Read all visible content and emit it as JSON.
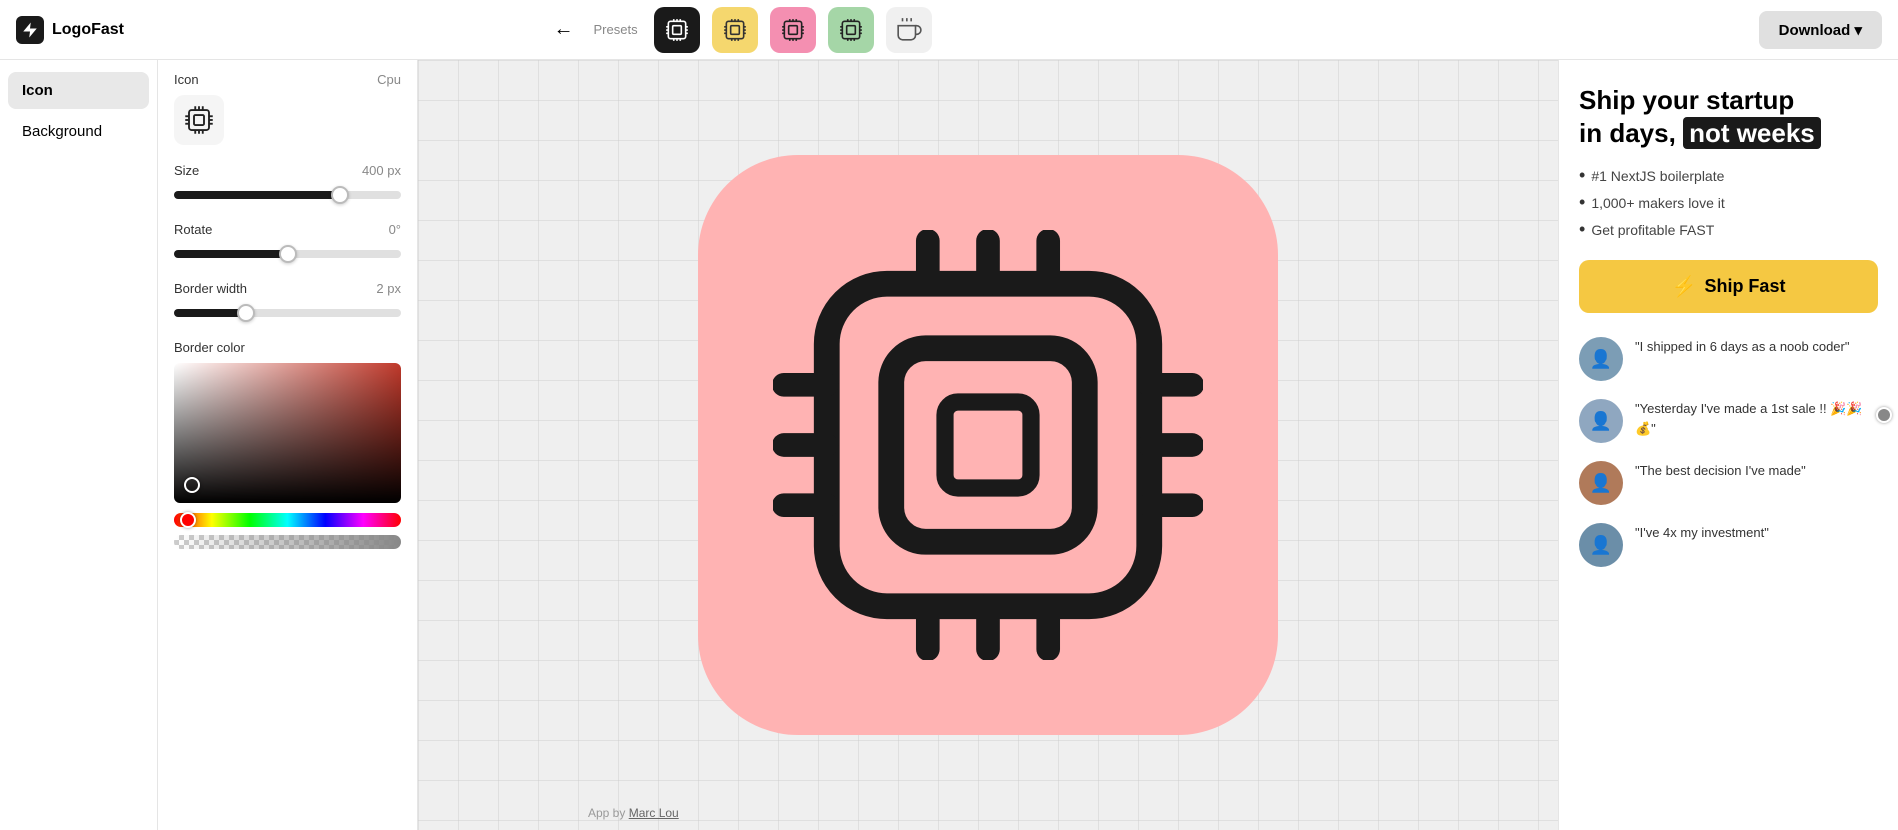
{
  "app": {
    "name": "LogoFast",
    "logo_symbol": "⚡"
  },
  "topbar": {
    "presets_label": "Presets",
    "download_label": "Download ▾"
  },
  "sidebar": {
    "tabs": [
      {
        "id": "icon",
        "label": "Icon",
        "active": true
      },
      {
        "id": "background",
        "label": "Background",
        "active": false
      }
    ]
  },
  "controls": {
    "icon_label": "Icon",
    "icon_value": "Cpu",
    "size_label": "Size",
    "size_value": "400 px",
    "size_pct": 75,
    "rotate_label": "Rotate",
    "rotate_value": "0°",
    "rotate_pct": 50,
    "border_width_label": "Border width",
    "border_width_value": "2 px",
    "border_width_pct": 30,
    "border_color_label": "Border color"
  },
  "right_panel": {
    "headline_1": "Ship your startup",
    "headline_2": "in days,",
    "headline_highlight": "not weeks",
    "bullets": [
      "#1 NextJS boilerplate",
      "1,000+ makers love it",
      "Get profitable FAST"
    ],
    "cta_label": "Ship Fast",
    "testimonials": [
      {
        "text": "\"I shipped in 6 days as a noob coder\""
      },
      {
        "text": "\"Yesterday I've made a 1st sale !! 🎉🎉💰\""
      },
      {
        "text": "\"The best decision I've made\""
      },
      {
        "text": "\"I've 4x my investment\""
      }
    ]
  },
  "app_credit": {
    "prefix": "App by ",
    "author": "Marc Lou",
    "url": "#"
  }
}
